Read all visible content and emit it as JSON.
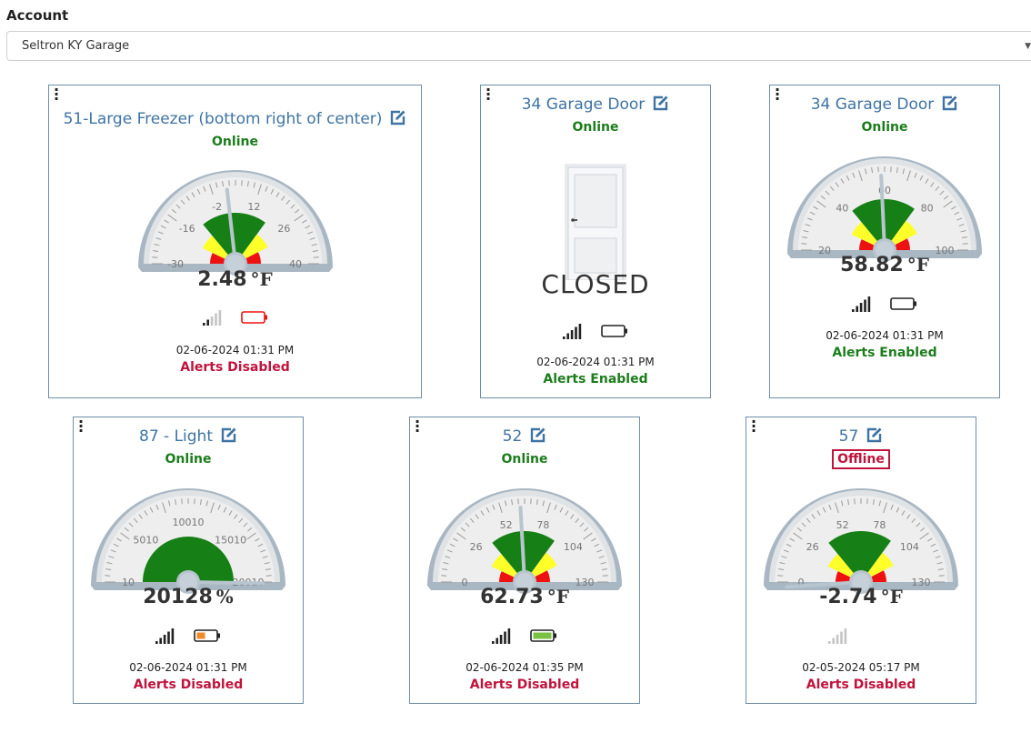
{
  "account": {
    "label": "Account",
    "selected": "Seltron KY Garage"
  },
  "devices": [
    {
      "title": "51-Large Freezer (bottom right of center)",
      "status": "Online",
      "type": "gauge",
      "ticks": [
        "-30",
        "-16",
        "-2",
        "12",
        "26",
        "40"
      ],
      "min": -30,
      "max": 40,
      "value": 2.48,
      "reading": "2.48",
      "unit": "°F",
      "signal_bars": 2,
      "battery": "empty-red",
      "timestamp": "02-06-2024 01:31 PM",
      "alerts": "Alerts Disabled"
    },
    {
      "title": "34 Garage Door",
      "status": "Online",
      "type": "door",
      "state": "CLOSED",
      "signal_bars": 5,
      "battery": "empty",
      "timestamp": "02-06-2024 01:31 PM",
      "alerts": "Alerts Enabled"
    },
    {
      "title": "34 Garage Door",
      "status": "Online",
      "type": "gauge",
      "ticks": [
        "20",
        "40",
        "60",
        "80",
        "100"
      ],
      "min": 20,
      "max": 100,
      "value": 58.82,
      "reading": "58.82",
      "unit": "°F",
      "signal_bars": 5,
      "battery": "empty",
      "timestamp": "02-06-2024 01:31 PM",
      "alerts": "Alerts Enabled"
    },
    {
      "title": "87 - Light",
      "status": "Online",
      "type": "gauge",
      "ticks": [
        "10",
        "5010",
        "10010",
        "15010",
        "20010"
      ],
      "min": 10,
      "max": 20010,
      "value": 20128,
      "reading": "20128",
      "unit": "%",
      "signal_bars": 5,
      "battery": "low-orange",
      "timestamp": "02-06-2024 01:31 PM",
      "alerts": "Alerts Disabled"
    },
    {
      "title": "52",
      "status": "Online",
      "type": "gauge",
      "ticks": [
        "0",
        "26",
        "52",
        "78",
        "104",
        "130"
      ],
      "min": 0,
      "max": 130,
      "value": 62.73,
      "reading": "62.73",
      "unit": "°F",
      "signal_bars": 5,
      "battery": "full-green",
      "timestamp": "02-06-2024 01:35 PM",
      "alerts": "Alerts Disabled"
    },
    {
      "title": "57",
      "status": "Offline",
      "type": "gauge",
      "ticks": [
        "0",
        "26",
        "52",
        "78",
        "104",
        "130"
      ],
      "min": 0,
      "max": 130,
      "value": -2.74,
      "reading": "-2.74",
      "unit": "°F",
      "signal_bars": 0,
      "battery": "none",
      "timestamp": "02-05-2024 05:17 PM",
      "alerts": "Alerts Disabled"
    }
  ],
  "colors": {
    "title": "#3e73a3",
    "online": "#1c7d1c",
    "alert_red": "#c0143c",
    "gauge_green": "#168016",
    "gauge_yellow": "#ffff2a",
    "gauge_red": "#ee1111",
    "card_border": "#6f8fa6"
  }
}
